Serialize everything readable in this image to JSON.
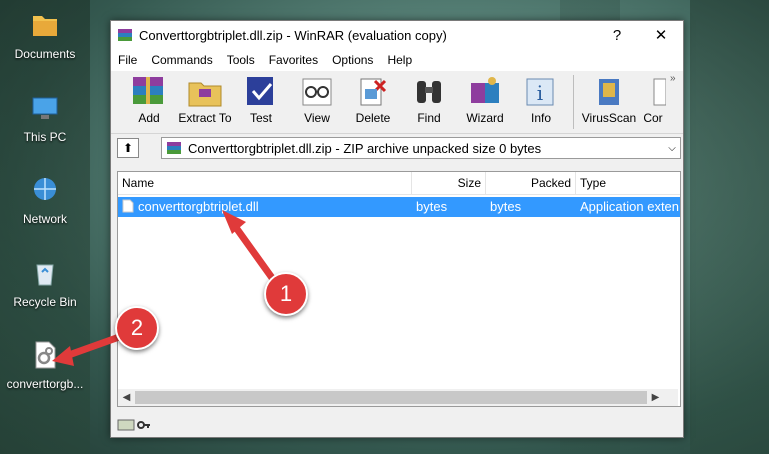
{
  "desktop": {
    "icons": [
      {
        "label": "Documents"
      },
      {
        "label": "This PC"
      },
      {
        "label": "Network"
      },
      {
        "label": "Recycle Bin"
      },
      {
        "label": "converttorgb..."
      }
    ]
  },
  "window": {
    "title": "Converttorgbtriplet.dll.zip - WinRAR (evaluation copy)",
    "help_glyph": "?",
    "close_glyph": "✕"
  },
  "menu": [
    "File",
    "Commands",
    "Tools",
    "Favorites",
    "Options",
    "Help"
  ],
  "toolbar": {
    "buttons": [
      "Add",
      "Extract To",
      "Test",
      "View",
      "Delete",
      "Find",
      "Wizard",
      "Info",
      "VirusScan",
      "Cor"
    ],
    "more_glyph": "»"
  },
  "pathbar": {
    "up_glyph": "⬆",
    "path": "Converttorgbtriplet.dll.zip - ZIP archive unpacked size 0 bytes",
    "dropdown_glyph": "⌵"
  },
  "filelist": {
    "columns": {
      "name": "Name",
      "size": "Size",
      "packed": "Packed",
      "type": "Type"
    },
    "rows": [
      {
        "name": "converttorgbtriplet.dll",
        "size": "bytes",
        "packed": "bytes",
        "type": "Application exten"
      }
    ]
  },
  "annotations": {
    "badge1": "1",
    "badge2": "2"
  },
  "colors": {
    "selection": "#3399ff",
    "badge": "#e03a3a"
  }
}
